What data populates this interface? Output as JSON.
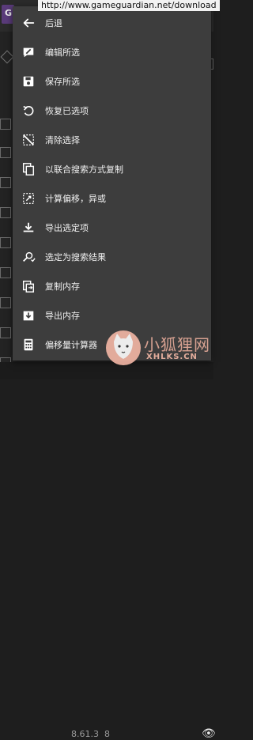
{
  "url_bar": {
    "text": "http://www.gameguardian.net/download"
  },
  "background": {
    "app_letter": "G",
    "version": "8.61.3",
    "version_suffix": "8"
  },
  "menu": {
    "items": [
      {
        "label": "后退",
        "icon": "back-arrow-icon"
      },
      {
        "label": "编辑所选",
        "icon": "edit-icon"
      },
      {
        "label": "保存所选",
        "icon": "save-icon"
      },
      {
        "label": "恢复已选项",
        "icon": "restore-icon"
      },
      {
        "label": "清除选择",
        "icon": "clear-selection-icon"
      },
      {
        "label": "以联合搜索方式复制",
        "icon": "copy-icon"
      },
      {
        "label": "计算偏移，异或",
        "icon": "calculate-offset-icon"
      },
      {
        "label": "导出选定项",
        "icon": "export-selected-icon"
      },
      {
        "label": "选定为搜索结果",
        "icon": "search-select-icon"
      },
      {
        "label": "复制内存",
        "icon": "copy-memory-icon"
      },
      {
        "label": "导出内存",
        "icon": "export-memory-icon"
      },
      {
        "label": "偏移量计算器",
        "icon": "calculator-icon"
      }
    ]
  },
  "watermark": {
    "text": "小狐狸网",
    "sub": "XHLKS.CN"
  }
}
